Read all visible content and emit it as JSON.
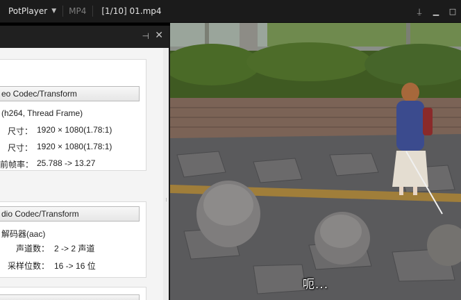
{
  "titlebar": {
    "app_name": "PotPlayer",
    "format": "MP4",
    "file_title": "[1/10] 01.mp4",
    "pin_glyph": "⍊",
    "minimize_glyph": "▁",
    "maximize_glyph": "□"
  },
  "panel": {
    "pin_glyph": "⊣",
    "close_glyph": "✕",
    "video": {
      "section_label": "eo Codec/Transform",
      "decoder": "(h264, Thread Frame)",
      "rows": [
        {
          "label": "尺寸：",
          "value": "1920 × 1080(1.78:1)"
        },
        {
          "label": "尺寸：",
          "value": "1920 × 1080(1.78:1)"
        },
        {
          "label": "前帧率：",
          "value": "25.788 -> 13.27"
        }
      ]
    },
    "audio": {
      "section_label": "dio Codec/Transform",
      "decoder": "解码器(aac)",
      "rows": [
        {
          "label": "声道数：",
          "value": "2 -> 2 声道"
        },
        {
          "label": "采样位数：",
          "value": "16 -> 16 位"
        }
      ]
    }
  },
  "video": {
    "subtitle": "呃..."
  }
}
